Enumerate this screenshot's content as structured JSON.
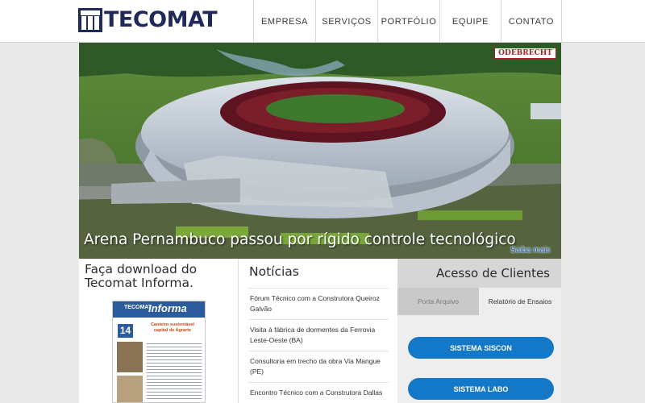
{
  "brand": {
    "name": "TECOMAT"
  },
  "nav": {
    "items": [
      {
        "label": "EMPRESA"
      },
      {
        "label": "SERVIÇOS"
      },
      {
        "label": "PORTFÓLIO"
      },
      {
        "label": "EQUIPE"
      },
      {
        "label": "CONTATO"
      }
    ]
  },
  "hero": {
    "sponsor": "ODEBRECHT",
    "title": "Arena Pernambuco passou por rígido controle tecnológico",
    "more_link": "Saiba mais"
  },
  "download": {
    "title": "Faça download do Tecomat Informa.",
    "magazine": {
      "brand": "TECOMAT",
      "name": "Informa",
      "issue": "14",
      "headline": "Canteiro sustentável capital de Agrarte"
    }
  },
  "news": {
    "title": "Notícias",
    "items": [
      {
        "text": "Fórum Técnico com a Construtora Queiroz Galvão"
      },
      {
        "text": "Visita à fábrica de dormentes da Ferrovia Leste-Oeste (BA)"
      },
      {
        "text": "Consultoria em trecho da obra Via Mangue (PE)"
      },
      {
        "text": "Encontro Técnico com a Construtora Dallas"
      }
    ]
  },
  "clients": {
    "title": "Acesso de Clientes",
    "tabs": [
      {
        "label": "Porta Arquivo",
        "active": false
      },
      {
        "label": "Relatório de Ensaios",
        "active": true
      }
    ],
    "buttons": [
      {
        "label": "SISTEMA SISCON"
      },
      {
        "label": "SISTEMA LABO"
      }
    ]
  },
  "colors": {
    "brand_navy": "#1f2a5a",
    "button_blue": "#1478c8",
    "link_blue": "#1d5fb0",
    "sponsor_red": "#b02020"
  }
}
